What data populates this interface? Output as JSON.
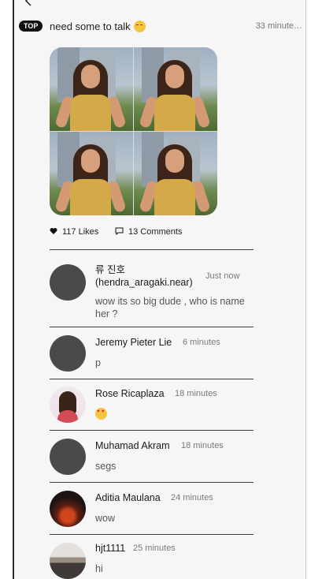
{
  "post": {
    "badge": "TOP",
    "title": "need some to talk",
    "title_emoji": "sad-face-emoji",
    "time": "33 minute…",
    "likes": "117 Likes",
    "comments_count": "13 Comments"
  },
  "comments": [
    {
      "name": "류 진호\n(hendra_aragaki.near)",
      "time": "Just now",
      "text": "wow its so big dude , who is name her ?"
    },
    {
      "name": "Jeremy Pieter Lie",
      "time": "6 minutes",
      "text": "p"
    },
    {
      "name": "Rose Ricaplaza",
      "time": "18 minutes",
      "text": "heart-eyes-emoji"
    },
    {
      "name": "Muhamad Akram",
      "time": "18 minutes",
      "text": "segs"
    },
    {
      "name": "Aditia Maulana",
      "time": "24 minutes",
      "text": "wow"
    },
    {
      "name": "hjt1111",
      "time": "25 minutes",
      "text": "hi"
    }
  ],
  "colors": {
    "badge_bg": "#111111",
    "panel_bg": "#f7f6f6",
    "avatar_placeholder": "#4a4a4a"
  }
}
